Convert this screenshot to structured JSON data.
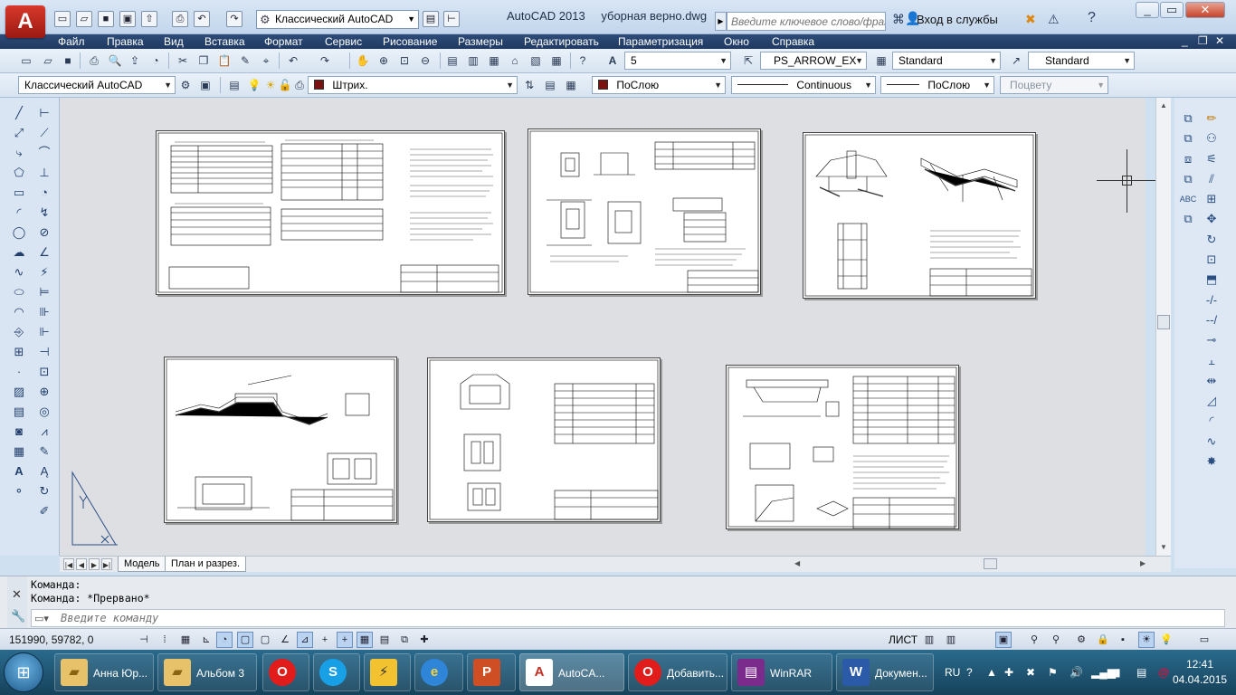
{
  "app": {
    "logo_letter": "A",
    "product": "AutoCAD 2013",
    "filename": "уборная верно.dwg",
    "workspace": "Классический AutoCAD",
    "search_placeholder": "Введите ключевое слово/фразу",
    "login": "Вход в службы"
  },
  "menu": [
    "Файл",
    "Правка",
    "Вид",
    "Вставка",
    "Формат",
    "Сервис",
    "Рисование",
    "Размеры",
    "Редактировать",
    "Параметризация",
    "Окно",
    "Справка"
  ],
  "toolbar2": {
    "text_height": "5",
    "dim_style": "PS_ARROW_EX",
    "text_style": "Standard",
    "table_style": "Standard"
  },
  "toolbar3": {
    "workspace": "Классический AutoCAD",
    "layer": "Штрих.",
    "color": "ПоСлою",
    "color_hex": "#7a1212",
    "linetype": "Continuous",
    "lineweight": "ПоСлою",
    "plot_style": "Поцвету"
  },
  "tabs": [
    "Модель",
    "План и разрез."
  ],
  "command": {
    "history": [
      "Команда:",
      "Команда: *Прервано*"
    ],
    "placeholder": "Введите команду"
  },
  "status": {
    "coords": "151990, 59782, 0",
    "paper_label": "ЛИСТ"
  },
  "taskbar": {
    "items": [
      {
        "label": "Анна Юр...",
        "icon": "folder-icon"
      },
      {
        "label": "Альбом 3",
        "icon": "folder-icon"
      },
      {
        "label": "",
        "icon": "opera-icon"
      },
      {
        "label": "",
        "icon": "skype-icon"
      },
      {
        "label": "",
        "icon": "zip-tool-icon"
      },
      {
        "label": "",
        "icon": "internet-explorer-icon"
      },
      {
        "label": "",
        "icon": "powerpoint-icon"
      },
      {
        "label": "AutoCA...",
        "icon": "autocad-icon"
      },
      {
        "label": "Добавить...",
        "icon": "opera-icon"
      },
      {
        "label": "WinRAR",
        "icon": "winrar-icon"
      },
      {
        "label": "Докумен...",
        "icon": "word-icon"
      }
    ],
    "language": "RU",
    "time": "12:41",
    "date": "04.04.2015"
  },
  "colors": {
    "accent": "#d8382b",
    "menubar": "#1f3a62",
    "canvas": "#dedfe2"
  }
}
